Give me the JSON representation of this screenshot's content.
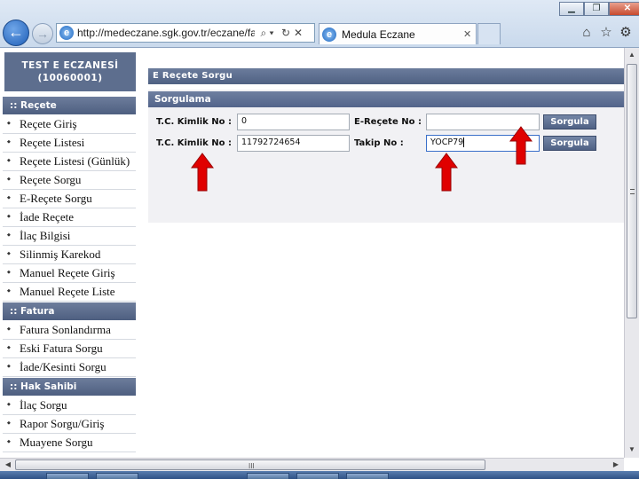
{
  "browser": {
    "address_url": "http://medeczane.sgk.gov.tr/eczane/faces/",
    "tab_title": "Medula Eczane",
    "address_search_glyph": "⌕ ▾",
    "refresh_glyph": "↻",
    "stop_glyph": "✕",
    "tab_close_glyph": "✕",
    "window_minimize_glyph": "▁",
    "window_restore_glyph": "❐",
    "window_close_glyph": "✕",
    "back_glyph": "←",
    "forward_glyph": "→",
    "home_glyph": "⌂",
    "favorites_glyph": "☆",
    "settings_glyph": "⚙",
    "favicon_glyph": "e"
  },
  "sidebar": {
    "pharmacy_name": "TEST E ECZANESİ",
    "pharmacy_code": "(10060001)",
    "sections": [
      {
        "title": ":: Reçete",
        "items": [
          "Reçete Giriş",
          "Reçete Listesi",
          "Reçete Listesi (Günlük)",
          "Reçete Sorgu",
          "E-Reçete Sorgu",
          "İade Reçete",
          "İlaç Bilgisi",
          "Silinmiş Karekod",
          "Manuel Reçete Giriş",
          "Manuel Reçete Liste"
        ]
      },
      {
        "title": ":: Fatura",
        "items": [
          "Fatura Sonlandırma",
          "Eski Fatura Sorgu",
          "İade/Kesinti Sorgu"
        ]
      },
      {
        "title": ":: Hak Sahibi",
        "items": [
          "İlaç Sorgu",
          "Rapor Sorgu/Giriş",
          "Muayene Sorgu"
        ]
      }
    ]
  },
  "main": {
    "header": "E Reçete Sorgu",
    "panel_title": "Sorgulama",
    "row1": {
      "tc_label": "T.C. Kimlik No :",
      "tc_value": "0",
      "ereceipt_label": "E-Reçete No :",
      "ereceipt_value": "",
      "button": "Sorgula"
    },
    "row2": {
      "tc_label": "T.C. Kimlik No :",
      "tc_value": "11792724654",
      "takip_label": "Takip No :",
      "takip_value": "YOCP79",
      "button": "Sorgula"
    }
  },
  "scrollbar": {
    "up_glyph": "▲",
    "down_glyph": "▼",
    "left_glyph": "◀",
    "right_glyph": "▶",
    "grip_glyph": "III"
  },
  "colors": {
    "header_blue": "#5d6e8e",
    "annotation_red": "#e00000"
  }
}
